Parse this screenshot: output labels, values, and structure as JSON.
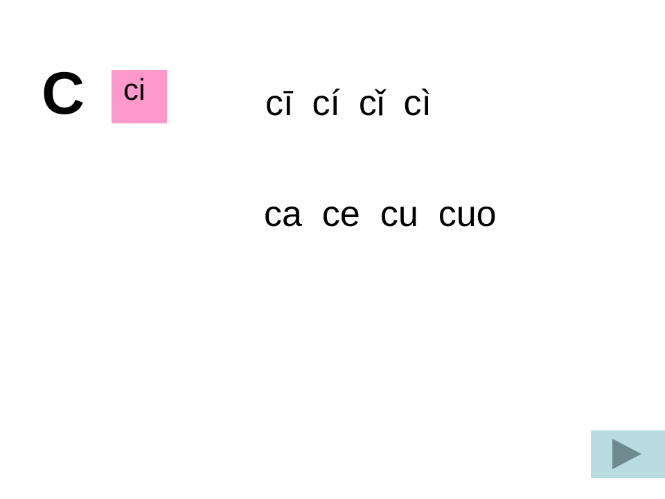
{
  "slide": {
    "background_color": "#ffffff",
    "initial_letter": "C",
    "highlight": {
      "syllable": "ci",
      "background_color": "#ff99cc",
      "text_color": "#000000"
    },
    "tone_row": {
      "label": "tone-variations",
      "syllables": [
        "cī",
        "cí",
        "cǐ",
        "cì"
      ]
    },
    "final_row": {
      "label": "syllable-combinations",
      "syllables": [
        "ca",
        "ce",
        "cu",
        "cuo"
      ]
    },
    "navigation": {
      "next_button": {
        "icon": "play-triangle-icon",
        "background_color": "#b8dce0",
        "icon_color": "#6e8c8f"
      }
    }
  }
}
